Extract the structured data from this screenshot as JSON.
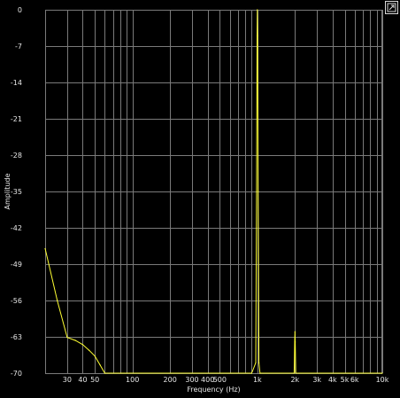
{
  "chart_data": {
    "type": "line",
    "title": "",
    "xlabel": "Frequency (Hz)",
    "ylabel": "Amplitude",
    "x_scale": "log",
    "xlim": [
      20,
      10000
    ],
    "ylim": [
      -70,
      0
    ],
    "grid": true,
    "background": "#000000",
    "grid_color": "#7a7a7a",
    "line_color": "#ffff33",
    "x_ticks": [
      {
        "value": 30,
        "label": "30"
      },
      {
        "value": 40,
        "label": "40"
      },
      {
        "value": 50,
        "label": "50"
      },
      {
        "value": 100,
        "label": "100"
      },
      {
        "value": 200,
        "label": "200"
      },
      {
        "value": 300,
        "label": "300"
      },
      {
        "value": 400,
        "label": "400"
      },
      {
        "value": 500,
        "label": "500"
      },
      {
        "value": 1000,
        "label": "1k"
      },
      {
        "value": 2000,
        "label": "2k"
      },
      {
        "value": 3000,
        "label": "3k"
      },
      {
        "value": 4000,
        "label": "4k"
      },
      {
        "value": 5000,
        "label": "5k"
      },
      {
        "value": 6000,
        "label": "6k"
      },
      {
        "value": 10000,
        "label": "10k"
      }
    ],
    "y_ticks": [
      0,
      -7,
      -14,
      -21,
      -28,
      -35,
      -42,
      -49,
      -56,
      -63,
      -70
    ],
    "series": [
      {
        "values": [
          [
            20,
            -46
          ],
          [
            25,
            -56
          ],
          [
            30,
            -63.1
          ],
          [
            35,
            -63.7
          ],
          [
            40,
            -64.5
          ],
          [
            45,
            -65.6
          ],
          [
            50,
            -66.7
          ],
          [
            55,
            -68.4
          ],
          [
            60,
            -70
          ],
          [
            900,
            -70
          ],
          [
            970,
            -68
          ],
          [
            985,
            -35
          ],
          [
            995,
            -5
          ],
          [
            1000,
            0
          ],
          [
            1005,
            -5
          ],
          [
            1015,
            -35
          ],
          [
            1030,
            -68
          ],
          [
            1050,
            -70
          ],
          [
            1970,
            -70
          ],
          [
            1990,
            -64
          ],
          [
            2000,
            -62
          ],
          [
            2010,
            -64
          ],
          [
            2030,
            -70
          ],
          [
            10000,
            -70
          ]
        ]
      }
    ]
  },
  "controls": {
    "expand_icon": "expand-icon"
  }
}
